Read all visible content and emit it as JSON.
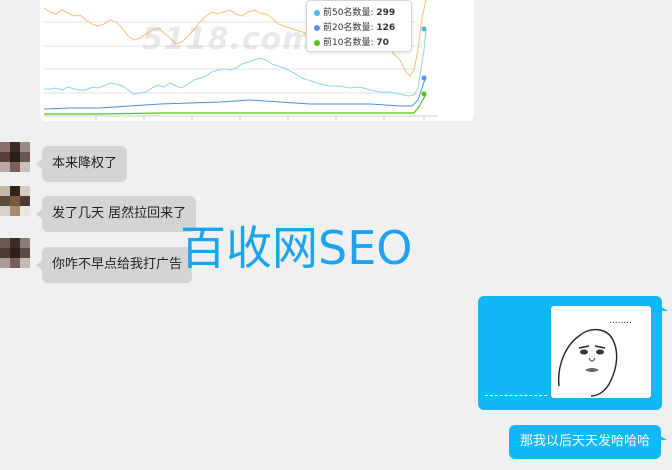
{
  "chart": {
    "watermark": "5118.com",
    "tooltip": [
      {
        "label": "前50名数量",
        "value": "299",
        "color": "#4ab8e8"
      },
      {
        "label": "前20名数量",
        "value": "126",
        "color": "#5b8ff9"
      },
      {
        "label": "前10名数量",
        "value": "70",
        "color": "#52c41a"
      }
    ],
    "series_colors": {
      "top50": "#f5c27a",
      "top20": "#8fd3f0",
      "top10": "#52c41a",
      "base": "#4a90d9"
    }
  },
  "messages": {
    "incoming": [
      {
        "text": "本来降权了"
      },
      {
        "text": "发了几天 居然拉回来了"
      },
      {
        "text": "你咋不早点给我打广告"
      }
    ],
    "outgoing_image": {
      "caption_dots": "........",
      "type": "meme-sticker"
    },
    "outgoing_text": "那我以后天天发哈哈哈"
  },
  "overlay_watermark": "百收网SEO",
  "colors": {
    "bubble_out": "#12b7f5",
    "bubble_in": "#d4d4d4",
    "background": "#f0f0f0",
    "watermark": "#1ea4ee"
  }
}
